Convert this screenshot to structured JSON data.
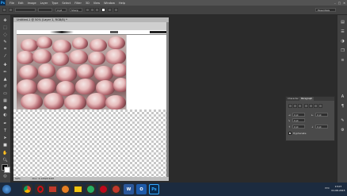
{
  "app": {
    "logo": "Ps",
    "menus": [
      "File",
      "Edit",
      "Image",
      "Layer",
      "Type",
      "Select",
      "Filter",
      "3D",
      "View",
      "Window",
      "Help"
    ],
    "window_controls": [
      "–",
      "□",
      "✕"
    ]
  },
  "options": {
    "font_family": "",
    "font_style": "",
    "font_size": "4 pt",
    "anti_alias": "Sharp",
    "workspace": "Essentials"
  },
  "document": {
    "tab_title": "Untitled-1 @ 50% (Layer 1, RGB/8) *",
    "zoom": "50%",
    "doc_info": "Doc: 4,12M/4,50M"
  },
  "paragraph_panel": {
    "tabs": [
      "Character",
      "Paragraph"
    ],
    "active_tab": "Paragraph",
    "indent_left": "0 pt",
    "indent_right": "0 pt",
    "indent_first": "0 pt",
    "space_before": "0 pt",
    "space_after": "0 pt",
    "hyphenate_label": "Hyphenate",
    "hyphenate_checked": true
  },
  "taskbar": {
    "apps": [
      {
        "name": "Chrome",
        "icon": "chrome-icon",
        "color": "#d93025"
      },
      {
        "name": "Opera",
        "icon": "opera-icon",
        "color": "#cc0f16"
      },
      {
        "name": "Mail",
        "icon": "mail-icon",
        "color": "#c0392b"
      },
      {
        "name": "Word",
        "icon": "word-icon",
        "color": "#2b579a"
      },
      {
        "name": "Outlook",
        "icon": "outlook-icon",
        "color": "#1e5aa8"
      },
      {
        "name": "Photoshop",
        "icon": "photoshop-icon",
        "color": "#0a2b4e"
      }
    ],
    "tray_lang": "РУС",
    "time": "13:07",
    "date": "01.06.2015"
  }
}
